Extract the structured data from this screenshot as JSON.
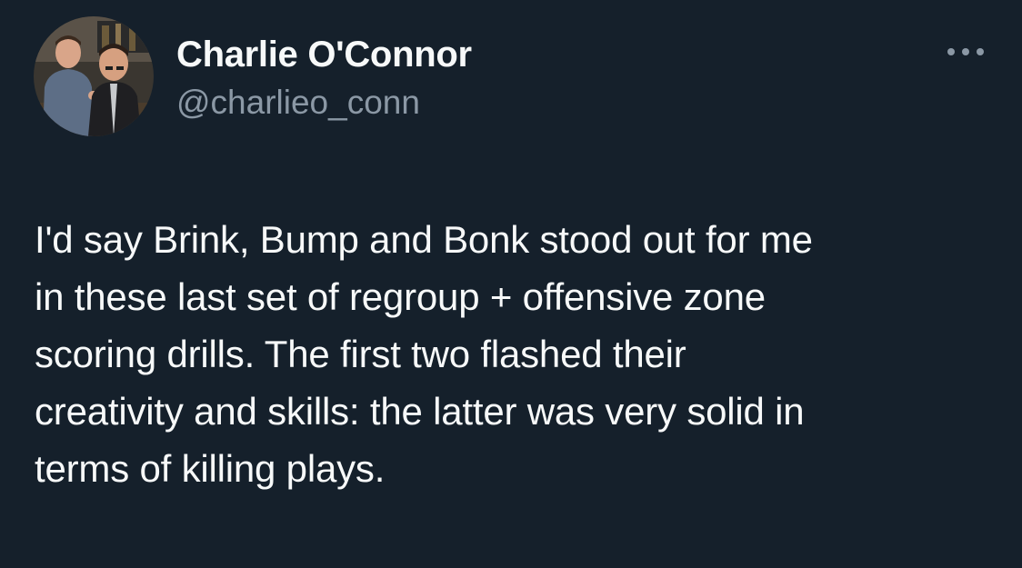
{
  "tweet": {
    "author": {
      "display_name": "Charlie O'Connor",
      "handle": "@charlieo_conn",
      "avatar": "profile-photo"
    },
    "more_icon": "more-horizontal-icon",
    "text": "I'd say Brink, Bump and Bonk stood out for me\nin these last set of regroup + offensive zone\nscoring drills. The first two flashed their\ncreativity and skills: the latter was very solid in\nterms of killing plays."
  },
  "colors": {
    "background": "#15202b",
    "primary_text": "#f7f9f9",
    "secondary_text": "#8b98a5"
  }
}
